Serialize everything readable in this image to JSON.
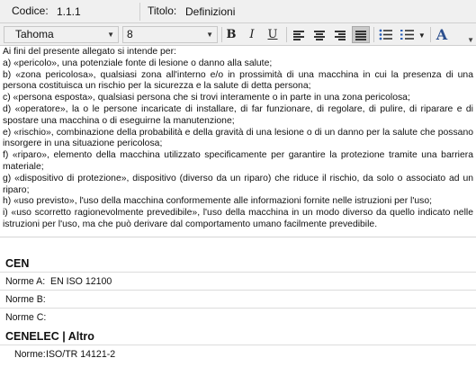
{
  "header": {
    "code_label": "Codice:",
    "code_value": "1.1.1",
    "title_label": "Titolo:",
    "title_value": "Definizioni"
  },
  "toolbar": {
    "font_name": "Tahoma",
    "font_size": "8",
    "bold_label": "B",
    "italic_label": "I",
    "underline_label": "U",
    "text_color_label": "A"
  },
  "editor": {
    "intro": "Ai fini del presente allegato si intende per:",
    "items": [
      "a) «pericolo», una potenziale fonte di lesione o danno alla salute;",
      "b) «zona pericolosa», qualsiasi zona all'interno e/o in prossimità di una macchina in cui la presenza di una persona costituisca un rischio per la sicurezza e la salute di detta persona;",
      "c) «persona esposta», qualsiasi persona che si trovi interamente o in parte in una zona pericolosa;",
      "d) «operatore», la o le persone incaricate di installare, di far funzionare, di regolare, di pulire, di riparare e di spostare una macchina o di eseguirne la manutenzione;",
      "e) «rischio», combinazione della probabilità e della gravità di una lesione o di un danno per la salute che possano insorgere in una situazione pericolosa;",
      "f) «riparo», elemento della macchina utilizzato specificamente per garantire la protezione tramite una barriera materiale;",
      "g) «dispositivo di protezione», dispositivo (diverso da un riparo) che riduce il rischio, da solo o associato ad un riparo;",
      "h) «uso previsto», l'uso della macchina conformemente alle informazioni fornite nelle istruzioni per l'uso;",
      "i) «uso scorretto ragionevolmente prevedibile», l'uso della macchina in un modo diverso da quello indicato nelle istruzioni per l'uso, ma che può derivare dal comportamento umano facilmente prevedibile."
    ]
  },
  "cen": {
    "title": "CEN",
    "rows": [
      {
        "label": "Norme A:",
        "value": "EN ISO 12100"
      },
      {
        "label": "Norme B:",
        "value": ""
      },
      {
        "label": "Norme C:",
        "value": ""
      }
    ]
  },
  "cenelec": {
    "title": "CENELEC | Altro",
    "rows": [
      {
        "label": "Norme:",
        "value": "ISO/TR 14121-2"
      }
    ]
  },
  "icons": [
    "align-left-icon",
    "align-center-icon",
    "align-right-icon",
    "align-justify-icon",
    "bullet-list-icon",
    "numbered-list-icon",
    "text-color-icon",
    "scroll-down-icon"
  ]
}
